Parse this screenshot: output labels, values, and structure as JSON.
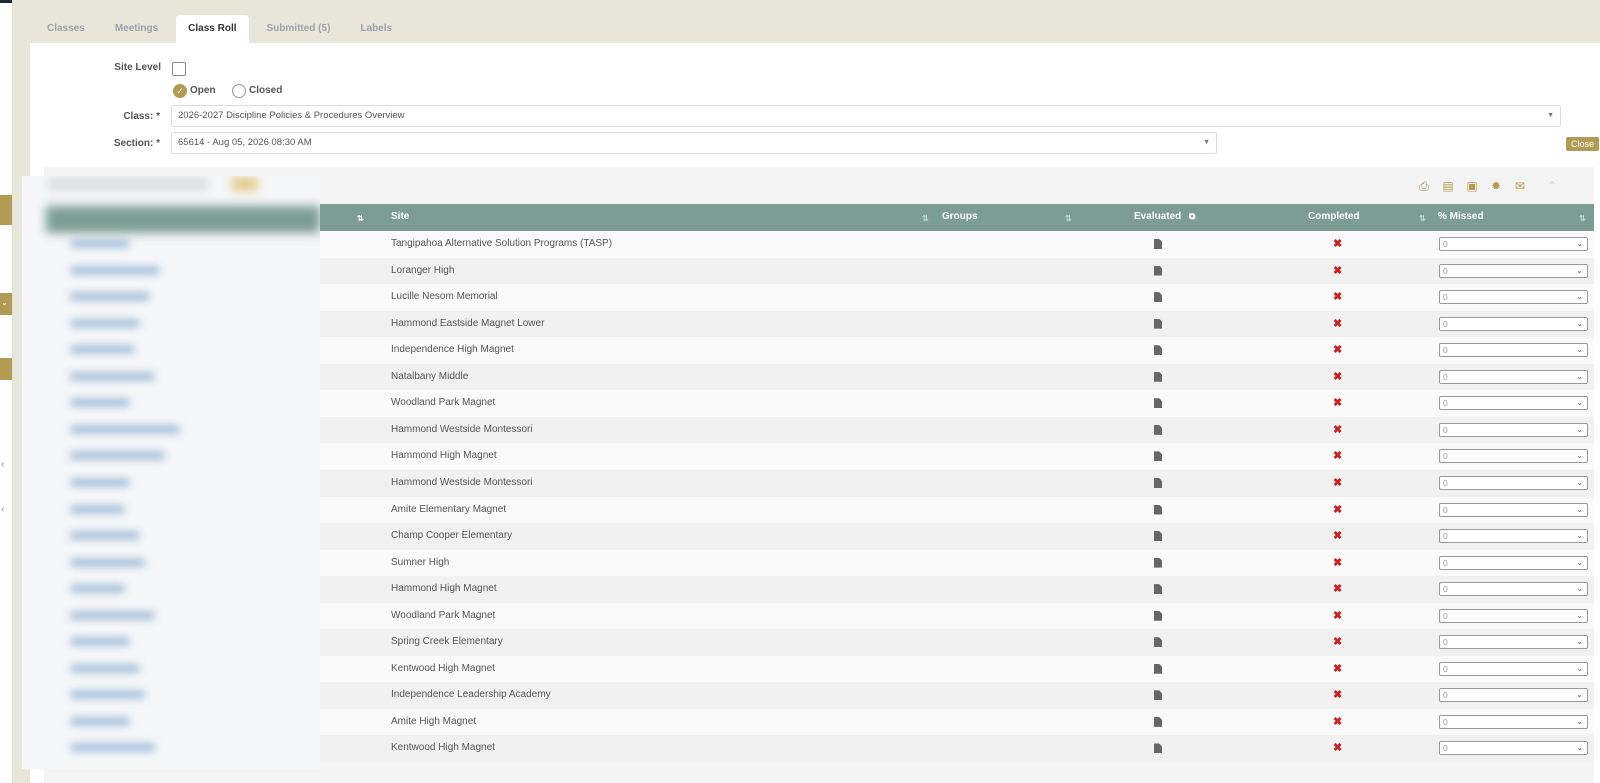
{
  "tabs": [
    {
      "label": "Classes",
      "active": false
    },
    {
      "label": "Meetings",
      "active": false
    },
    {
      "label": "Class Roll",
      "active": true
    },
    {
      "label": "Submitted (5)",
      "active": false
    },
    {
      "label": "Labels",
      "active": false
    }
  ],
  "form": {
    "site_level_label": "Site Level",
    "open_label": "Open",
    "closed_label": "Closed",
    "status_selected": "Open",
    "class_label": "Class: *",
    "class_value": "2026-2027 Discipline Policies & Procedures Overview",
    "section_label": "Section: *",
    "section_value": "65614 - Aug 05, 2026 08:30 AM",
    "close_button": "Close"
  },
  "toolbar": {
    "icons": [
      "print-icon",
      "document-icon",
      "badge-icon",
      "certificate-icon",
      "envelope-icon",
      "chevron-up-icon"
    ]
  },
  "table": {
    "headers": {
      "site": "Site",
      "groups": "Groups",
      "evaluated": "Evaluated",
      "completed": "Completed",
      "missed": "% Missed"
    },
    "rows": [
      {
        "site": "Tangipahoa Alternative Solution Programs (TASP)",
        "completed": "✖",
        "missed": "0"
      },
      {
        "site": "Loranger High",
        "completed": "✖",
        "missed": "0"
      },
      {
        "site": "Lucille Nesom Memorial",
        "completed": "✖",
        "missed": "0"
      },
      {
        "site": "Hammond Eastside Magnet Lower",
        "completed": "✖",
        "missed": "0"
      },
      {
        "site": "Independence High Magnet",
        "completed": "✖",
        "missed": "0"
      },
      {
        "site": "Natalbany Middle",
        "completed": "✖",
        "missed": "0"
      },
      {
        "site": "Woodland Park Magnet",
        "completed": "✖",
        "missed": "0"
      },
      {
        "site": "Hammond Westside Montessori",
        "completed": "✖",
        "missed": "0"
      },
      {
        "site": "Hammond High Magnet",
        "completed": "✖",
        "missed": "0"
      },
      {
        "site": "Hammond Westside Montessori",
        "completed": "✖",
        "missed": "0"
      },
      {
        "site": "Amite Elementary Magnet",
        "completed": "✖",
        "missed": "0"
      },
      {
        "site": "Champ Cooper Elementary",
        "completed": "✖",
        "missed": "0"
      },
      {
        "site": "Sumner High",
        "completed": "✖",
        "missed": "0"
      },
      {
        "site": "Hammond High Magnet",
        "completed": "✖",
        "missed": "0"
      },
      {
        "site": "Woodland Park Magnet",
        "completed": "✖",
        "missed": "0"
      },
      {
        "site": "Spring Creek Elementary",
        "completed": "✖",
        "missed": "0"
      },
      {
        "site": "Kentwood High Magnet",
        "completed": "✖",
        "missed": "0"
      },
      {
        "site": "Independence Leadership Academy",
        "completed": "✖",
        "missed": "0"
      },
      {
        "site": "Amite High Magnet",
        "completed": "✖",
        "missed": "0"
      },
      {
        "site": "Kentwood High Magnet",
        "completed": "✖",
        "missed": "0"
      }
    ]
  },
  "colors": {
    "accent": "#b39a52",
    "header": "#7c9d93",
    "incomplete": "#cc2222"
  }
}
